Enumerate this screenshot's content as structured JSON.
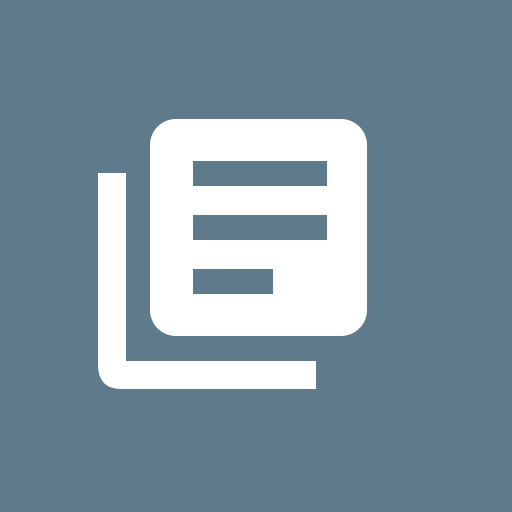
{
  "icon": {
    "name": "library-books-icon",
    "background_color": "#5f7b8b",
    "foreground_color": "#ffffff"
  }
}
